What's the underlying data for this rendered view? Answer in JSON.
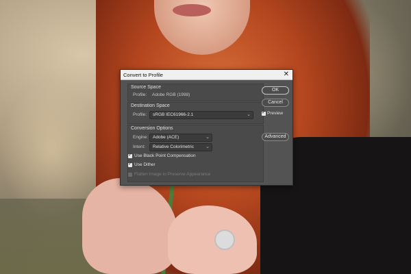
{
  "dialog": {
    "title": "Convert to Profile",
    "close_glyph": "✕",
    "source_space": {
      "heading": "Source Space",
      "profile_label": "Profile:",
      "profile_value": "Adobe RGB (1998)"
    },
    "destination_space": {
      "heading": "Destination Space",
      "profile_label": "Profile:",
      "profile_value": "sRGB IEC61966-2.1"
    },
    "conversion_options": {
      "heading": "Conversion Options",
      "engine_label": "Engine:",
      "engine_value": "Adobe (ACE)",
      "intent_label": "Intent:",
      "intent_value": "Relative Colorimetric",
      "black_point_label": "Use Black Point Compensation",
      "black_point_checked": true,
      "dither_label": "Use Dither",
      "dither_checked": true,
      "flatten_label": "Flatten Image to Preserve Appearance",
      "flatten_checked": false,
      "flatten_disabled": true
    },
    "buttons": {
      "ok": "OK",
      "cancel": "Cancel",
      "advanced": "Advanced"
    },
    "preview_label": "Preview",
    "preview_checked": true,
    "check_glyph": "✓",
    "chevron_glyph": "⌄"
  },
  "colors": {
    "dialog_bg": "#535353",
    "titlebar_bg": "#f0f0f0",
    "field_bg": "#3b3b3b"
  }
}
